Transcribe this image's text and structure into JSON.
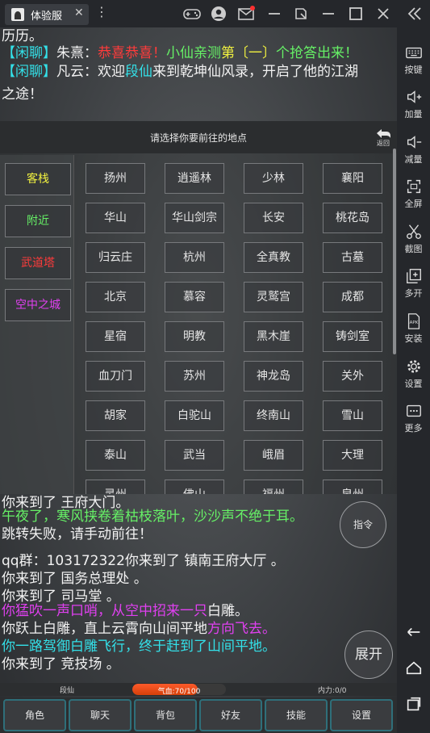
{
  "titlebar": {
    "tab_label": "体验服",
    "tab_close": "✕",
    "menu_glyph": "⋮",
    "icons": [
      "gamepad-icon",
      "user-icon",
      "mail-icon",
      "minimize-icon",
      "resize-icon",
      "minimize-window-icon",
      "maximize-icon",
      "close-icon",
      "collapse-icon"
    ]
  },
  "sidebar": {
    "items": [
      {
        "label": "按键",
        "icon": "keyboard-icon"
      },
      {
        "label": "加量",
        "icon": "volume-up-icon"
      },
      {
        "label": "减量",
        "icon": "volume-down-icon"
      },
      {
        "label": "全屏",
        "icon": "fullscreen-icon"
      },
      {
        "label": "截图",
        "icon": "scissors-icon"
      },
      {
        "label": "多开",
        "icon": "multi-instance-icon"
      },
      {
        "label": "安装",
        "icon": "apk-icon"
      },
      {
        "label": "设置",
        "icon": "gear-icon"
      },
      {
        "label": "更多",
        "icon": "more-icon"
      }
    ],
    "apk_text": "APK",
    "bottom_icons": [
      "back-icon",
      "home-icon",
      "recent-apps-icon"
    ]
  },
  "chat_top": {
    "line1": "历历。",
    "line2": {
      "tag": "【闲聊】",
      "speaker": "朱熹：",
      "red": "恭喜恭喜！",
      "green1": "小仙亲测",
      "yellow": "第〔一〕",
      "green2": "个抢答出来！"
    },
    "line3": {
      "tag": "【闲聊】",
      "text": "凡云：欢迎",
      "name": "段仙",
      "rest": "来到乾坤仙风录，开启了他的江湖"
    },
    "line4": "之途！"
  },
  "dialog": {
    "title": "请选择你要前往的地点",
    "back_label": "返回",
    "categories": [
      {
        "label": "客栈",
        "color": "#f0f040"
      },
      {
        "label": "附近",
        "color": "#66f066"
      },
      {
        "label": "武道塔",
        "color": "#ff3b3b"
      },
      {
        "label": "空中之城",
        "color": "#e040f0"
      }
    ],
    "locations": [
      "扬州",
      "逍遥林",
      "少林",
      "襄阳",
      "华山",
      "华山剑宗",
      "长安",
      "桃花岛",
      "归云庄",
      "杭州",
      "全真教",
      "古墓",
      "北京",
      "慕容",
      "灵鹫宫",
      "成都",
      "星宿",
      "明教",
      "黑木崖",
      "铸剑室",
      "血刀门",
      "苏州",
      "神龙岛",
      "关外",
      "胡家",
      "白驼山",
      "终南山",
      "雪山",
      "泰山",
      "武当",
      "峨眉",
      "大理",
      "灵州",
      "佛山",
      "福州",
      "泉州"
    ]
  },
  "chat_bottom": {
    "line0": "你来到了 王府大门。",
    "line1": "午夜了，寒风挟卷着枯枝落叶，沙沙声不绝于耳。",
    "line2": "跳转失败，请手动前往！",
    "line3": "qq群：103172322你来到了 镇南王府大厅 。",
    "line4": "你来到了 国务总理处 。",
    "line5": "你来到了 司马堂 。",
    "line6_magenta": "你猛吹一声口哨，从空中招来一只",
    "line6_white": "白雕。",
    "line7_white": "你跃上白雕，直上云霄向山间平地",
    "line7_magenta": "方向飞去。",
    "line8": "你一路驾御白雕飞行，终于赶到了山间平地。",
    "line9": "你来到了 竞技场 。"
  },
  "buttons": {
    "command": "指令",
    "expand": "展开"
  },
  "status": {
    "name": "段仙",
    "hp_text": "气血:70/100",
    "hp_ratio": 0.7,
    "mp_text": "内力:0/0"
  },
  "nav": [
    "角色",
    "聊天",
    "背包",
    "好友",
    "技能",
    "设置"
  ]
}
